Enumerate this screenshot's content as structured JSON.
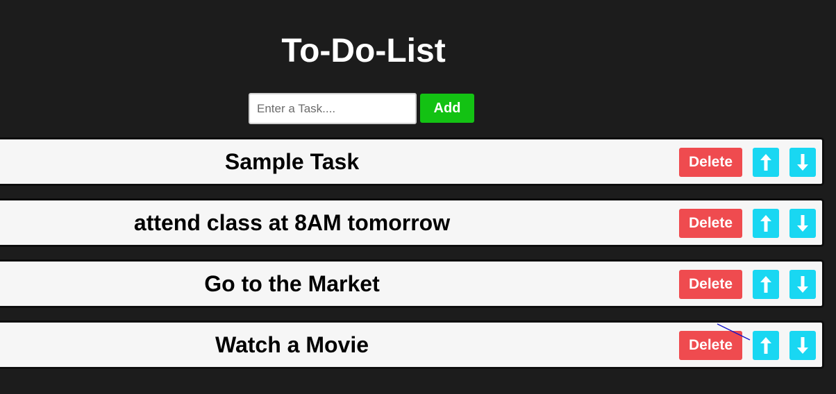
{
  "header": {
    "title": "To-Do-List"
  },
  "form": {
    "input_placeholder": "Enter a Task....",
    "input_value": "",
    "add_label": "Add"
  },
  "tasks": [
    {
      "text": "Sample Task",
      "delete_label": "Delete"
    },
    {
      "text": "attend class at 8AM tomorrow",
      "delete_label": "Delete"
    },
    {
      "text": "Go to the Market",
      "delete_label": "Delete"
    },
    {
      "text": "Watch a Movie",
      "delete_label": "Delete"
    }
  ],
  "icons": {
    "move_up": "arrow-up-icon",
    "move_down": "arrow-down-icon"
  },
  "colors": {
    "background": "#1c1c1c",
    "add_button": "#13c213",
    "delete_button": "#ef4b4f",
    "move_button": "#19d7f2",
    "task_background": "#f6f6f6"
  }
}
